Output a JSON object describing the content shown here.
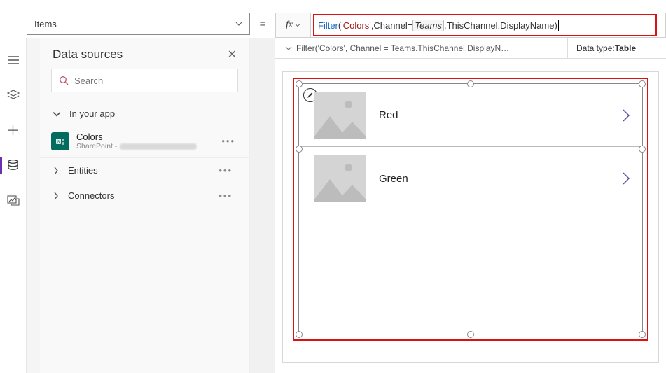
{
  "property_dropdown": {
    "value": "Items"
  },
  "equals": "=",
  "fx_label": "fx",
  "formula": {
    "fn": "Filter",
    "paren_open": "(",
    "arg1": "'Colors'",
    "comma1": ", ",
    "arg2a": "Channel",
    "eq": " = ",
    "teams": "Teams",
    "dot_chain": ".ThisChannel.DisplayName",
    "paren_close": ")"
  },
  "breadcrumb": {
    "text": "Filter('Colors', Channel = Teams.ThisChannel.DisplayN…",
    "datatype_label": "Data type: ",
    "datatype_value": "Table"
  },
  "panel": {
    "title": "Data sources",
    "search_placeholder": "Search",
    "section_in_app": "In your app",
    "ds_colors_title": "Colors",
    "ds_colors_sub_prefix": "SharePoint - ",
    "section_entities": "Entities",
    "section_connectors": "Connectors"
  },
  "gallery": {
    "items": [
      {
        "label": "Red"
      },
      {
        "label": "Green"
      }
    ]
  },
  "icons": {
    "hamburger": "hamburger-icon",
    "layers": "layers-icon",
    "plus": "plus-icon",
    "db": "database-icon",
    "media": "media-icon",
    "chevron_down": "chevron-down-icon",
    "chevron_right": "chevron-right-icon",
    "close": "close-icon",
    "search": "search-icon",
    "pencil": "pencil-icon"
  }
}
